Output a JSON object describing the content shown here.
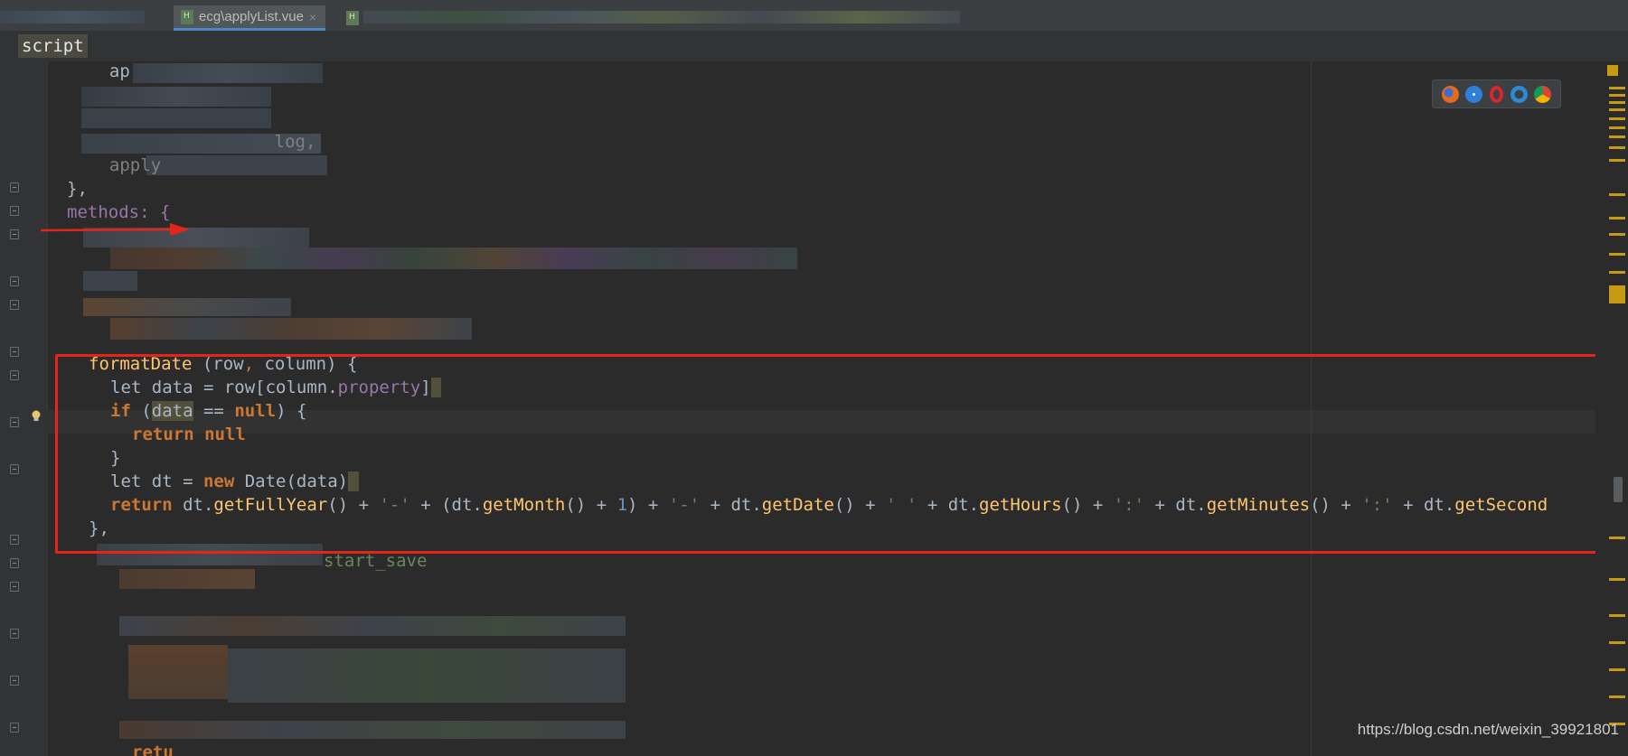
{
  "tabs": {
    "active_label": "ecg\\applyList.vue",
    "close_glyph": "×"
  },
  "breadcrumb": {
    "label": "script"
  },
  "code": {
    "lines": [
      {
        "text": "  ap"
      },
      {
        "text": "                      log,"
      },
      {
        "text": "  apply"
      },
      {
        "text": "},"
      },
      {
        "text": "methods: {"
      },
      {
        "text": "formatDate (row, column) {"
      },
      {
        "text": "let data = row[column.property]"
      },
      {
        "text": "if (data == null) {"
      },
      {
        "text": "return null"
      },
      {
        "text": "}"
      },
      {
        "text": "let dt = new Date(data)"
      },
      {
        "text": "return dt.getFullYear() + '-' + (dt.getMonth() + 1) + '-' + dt.getDate() + ' ' + dt.getHours() + ':' + dt.getMinutes() + ':' + dt.getSecond"
      },
      {
        "text": "},"
      },
      {
        "text": "start_save"
      },
      {
        "text": "retu"
      }
    ]
  },
  "browser_icons": [
    "firefox-icon",
    "safari-icon",
    "opera-icon",
    "ie-icon",
    "chrome-icon"
  ],
  "watermark": "https://blog.csdn.net/weixin_39921801",
  "colors": {
    "background": "#2b2b2b",
    "keyword": "#cc7832",
    "function": "#ffc66d",
    "property": "#9876aa",
    "string": "#6a8759",
    "number": "#6897bb",
    "highlight_box": "#e2261c"
  }
}
